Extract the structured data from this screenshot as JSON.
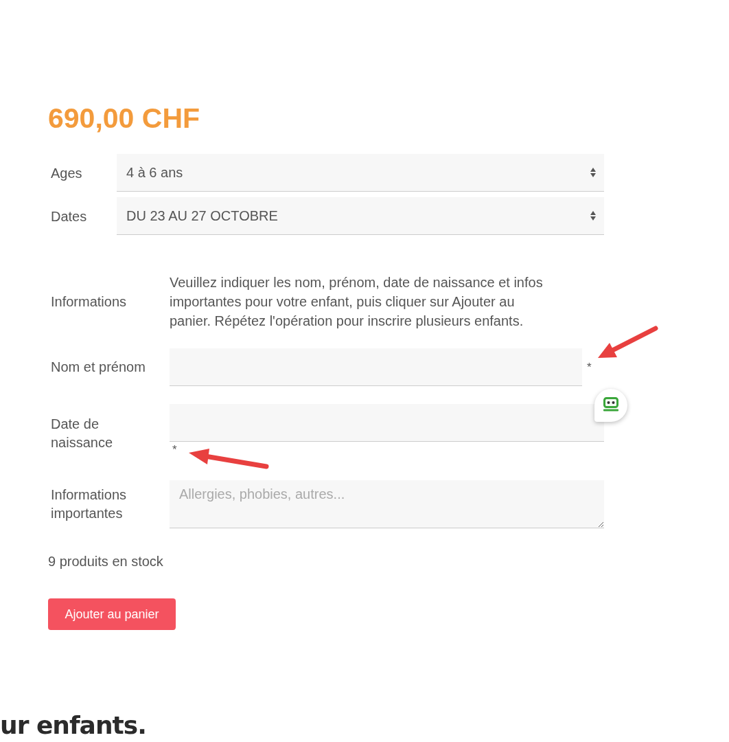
{
  "price": "690,00 CHF",
  "options": [
    {
      "label": "Ages",
      "value": "4 à 6 ans"
    },
    {
      "label": "Dates",
      "value": "DU 23 AU 27 OCTOBRE"
    }
  ],
  "fields": [
    {
      "kind": "note",
      "label": "Informations",
      "text": "Veuillez indiquer les nom, prénom, date de naissance et infos importantes pour votre enfant, puis cliquer sur Ajouter au panier. Répétez l'opération pour inscrire plusieurs enfants.",
      "annotated": false
    },
    {
      "kind": "text",
      "label": "Nom et prénom",
      "required_mark": "*",
      "annotated": true
    },
    {
      "kind": "date",
      "label": "Date de naissance",
      "required_mark": "*",
      "annotated": true
    },
    {
      "kind": "textarea",
      "label": "Informations importantes",
      "placeholder": "Allergies, phobies, autres...",
      "annotated": false
    }
  ],
  "stock": "9 produits en stock",
  "button": "Ajouter au panier",
  "footer_heading": "ur enfants."
}
